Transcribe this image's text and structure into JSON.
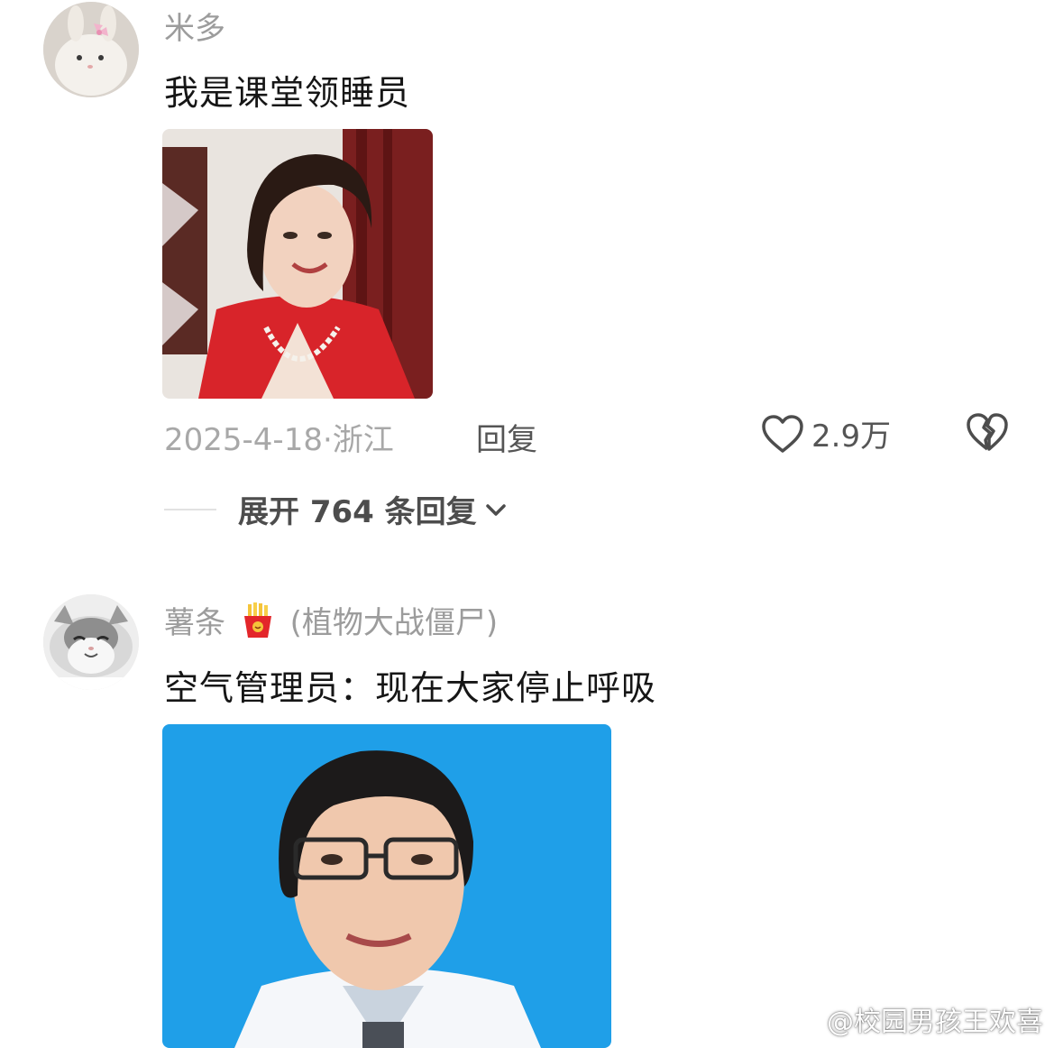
{
  "comments": [
    {
      "username": "米多",
      "text": "我是课堂领睡员",
      "date": "2025-4-18",
      "location": "浙江",
      "reply_label": "回复",
      "likes": "2.9万",
      "expand_label": "展开 764 条回复",
      "avatar_icon": "bunny-avatar-icon",
      "image_icon": "woman-red-jacket-photo"
    },
    {
      "username": "薯条",
      "badge_icon": "french-fries-icon",
      "game_tag": "(植物大战僵尸)",
      "text": "空气管理员：现在大家停止呼吸",
      "avatar_icon": "smiling-cat-avatar-icon",
      "image_icon": "man-glasses-lab-coat-photo"
    }
  ],
  "watermark": {
    "text": "@校园男孩王欢喜",
    "icon": "weibo-logo-icon"
  },
  "colors": {
    "meta_gray": "#a8a8a8",
    "text_dark": "#161616",
    "username_gray": "#9c9c9c"
  }
}
